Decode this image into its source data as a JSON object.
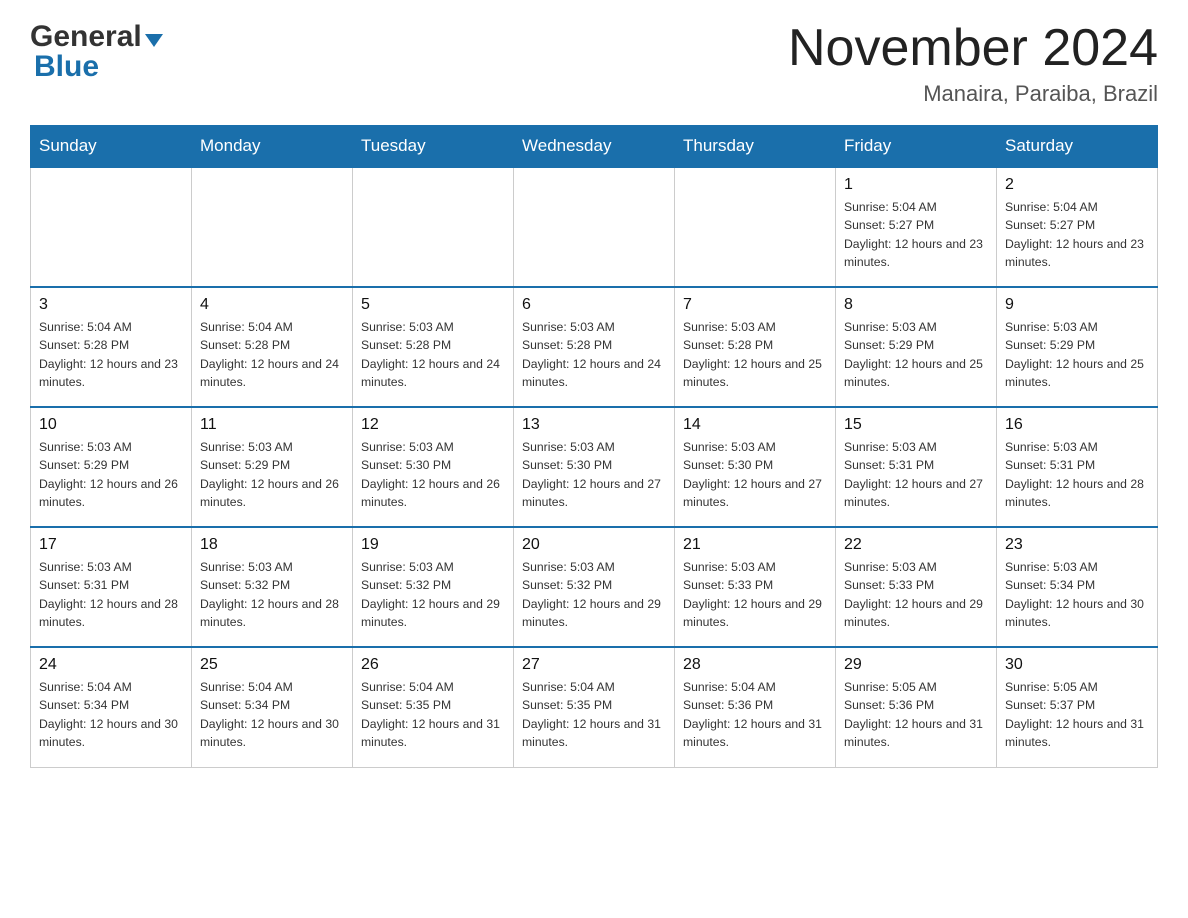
{
  "header": {
    "logo_general": "General",
    "logo_blue": "Blue",
    "month_title": "November 2024",
    "location": "Manaira, Paraiba, Brazil"
  },
  "weekdays": [
    "Sunday",
    "Monday",
    "Tuesday",
    "Wednesday",
    "Thursday",
    "Friday",
    "Saturday"
  ],
  "weeks": [
    [
      {
        "day": "",
        "sunrise": "",
        "sunset": "",
        "daylight": ""
      },
      {
        "day": "",
        "sunrise": "",
        "sunset": "",
        "daylight": ""
      },
      {
        "day": "",
        "sunrise": "",
        "sunset": "",
        "daylight": ""
      },
      {
        "day": "",
        "sunrise": "",
        "sunset": "",
        "daylight": ""
      },
      {
        "day": "",
        "sunrise": "",
        "sunset": "",
        "daylight": ""
      },
      {
        "day": "1",
        "sunrise": "Sunrise: 5:04 AM",
        "sunset": "Sunset: 5:27 PM",
        "daylight": "Daylight: 12 hours and 23 minutes."
      },
      {
        "day": "2",
        "sunrise": "Sunrise: 5:04 AM",
        "sunset": "Sunset: 5:27 PM",
        "daylight": "Daylight: 12 hours and 23 minutes."
      }
    ],
    [
      {
        "day": "3",
        "sunrise": "Sunrise: 5:04 AM",
        "sunset": "Sunset: 5:28 PM",
        "daylight": "Daylight: 12 hours and 23 minutes."
      },
      {
        "day": "4",
        "sunrise": "Sunrise: 5:04 AM",
        "sunset": "Sunset: 5:28 PM",
        "daylight": "Daylight: 12 hours and 24 minutes."
      },
      {
        "day": "5",
        "sunrise": "Sunrise: 5:03 AM",
        "sunset": "Sunset: 5:28 PM",
        "daylight": "Daylight: 12 hours and 24 minutes."
      },
      {
        "day": "6",
        "sunrise": "Sunrise: 5:03 AM",
        "sunset": "Sunset: 5:28 PM",
        "daylight": "Daylight: 12 hours and 24 minutes."
      },
      {
        "day": "7",
        "sunrise": "Sunrise: 5:03 AM",
        "sunset": "Sunset: 5:28 PM",
        "daylight": "Daylight: 12 hours and 25 minutes."
      },
      {
        "day": "8",
        "sunrise": "Sunrise: 5:03 AM",
        "sunset": "Sunset: 5:29 PM",
        "daylight": "Daylight: 12 hours and 25 minutes."
      },
      {
        "day": "9",
        "sunrise": "Sunrise: 5:03 AM",
        "sunset": "Sunset: 5:29 PM",
        "daylight": "Daylight: 12 hours and 25 minutes."
      }
    ],
    [
      {
        "day": "10",
        "sunrise": "Sunrise: 5:03 AM",
        "sunset": "Sunset: 5:29 PM",
        "daylight": "Daylight: 12 hours and 26 minutes."
      },
      {
        "day": "11",
        "sunrise": "Sunrise: 5:03 AM",
        "sunset": "Sunset: 5:29 PM",
        "daylight": "Daylight: 12 hours and 26 minutes."
      },
      {
        "day": "12",
        "sunrise": "Sunrise: 5:03 AM",
        "sunset": "Sunset: 5:30 PM",
        "daylight": "Daylight: 12 hours and 26 minutes."
      },
      {
        "day": "13",
        "sunrise": "Sunrise: 5:03 AM",
        "sunset": "Sunset: 5:30 PM",
        "daylight": "Daylight: 12 hours and 27 minutes."
      },
      {
        "day": "14",
        "sunrise": "Sunrise: 5:03 AM",
        "sunset": "Sunset: 5:30 PM",
        "daylight": "Daylight: 12 hours and 27 minutes."
      },
      {
        "day": "15",
        "sunrise": "Sunrise: 5:03 AM",
        "sunset": "Sunset: 5:31 PM",
        "daylight": "Daylight: 12 hours and 27 minutes."
      },
      {
        "day": "16",
        "sunrise": "Sunrise: 5:03 AM",
        "sunset": "Sunset: 5:31 PM",
        "daylight": "Daylight: 12 hours and 28 minutes."
      }
    ],
    [
      {
        "day": "17",
        "sunrise": "Sunrise: 5:03 AM",
        "sunset": "Sunset: 5:31 PM",
        "daylight": "Daylight: 12 hours and 28 minutes."
      },
      {
        "day": "18",
        "sunrise": "Sunrise: 5:03 AM",
        "sunset": "Sunset: 5:32 PM",
        "daylight": "Daylight: 12 hours and 28 minutes."
      },
      {
        "day": "19",
        "sunrise": "Sunrise: 5:03 AM",
        "sunset": "Sunset: 5:32 PM",
        "daylight": "Daylight: 12 hours and 29 minutes."
      },
      {
        "day": "20",
        "sunrise": "Sunrise: 5:03 AM",
        "sunset": "Sunset: 5:32 PM",
        "daylight": "Daylight: 12 hours and 29 minutes."
      },
      {
        "day": "21",
        "sunrise": "Sunrise: 5:03 AM",
        "sunset": "Sunset: 5:33 PM",
        "daylight": "Daylight: 12 hours and 29 minutes."
      },
      {
        "day": "22",
        "sunrise": "Sunrise: 5:03 AM",
        "sunset": "Sunset: 5:33 PM",
        "daylight": "Daylight: 12 hours and 29 minutes."
      },
      {
        "day": "23",
        "sunrise": "Sunrise: 5:03 AM",
        "sunset": "Sunset: 5:34 PM",
        "daylight": "Daylight: 12 hours and 30 minutes."
      }
    ],
    [
      {
        "day": "24",
        "sunrise": "Sunrise: 5:04 AM",
        "sunset": "Sunset: 5:34 PM",
        "daylight": "Daylight: 12 hours and 30 minutes."
      },
      {
        "day": "25",
        "sunrise": "Sunrise: 5:04 AM",
        "sunset": "Sunset: 5:34 PM",
        "daylight": "Daylight: 12 hours and 30 minutes."
      },
      {
        "day": "26",
        "sunrise": "Sunrise: 5:04 AM",
        "sunset": "Sunset: 5:35 PM",
        "daylight": "Daylight: 12 hours and 31 minutes."
      },
      {
        "day": "27",
        "sunrise": "Sunrise: 5:04 AM",
        "sunset": "Sunset: 5:35 PM",
        "daylight": "Daylight: 12 hours and 31 minutes."
      },
      {
        "day": "28",
        "sunrise": "Sunrise: 5:04 AM",
        "sunset": "Sunset: 5:36 PM",
        "daylight": "Daylight: 12 hours and 31 minutes."
      },
      {
        "day": "29",
        "sunrise": "Sunrise: 5:05 AM",
        "sunset": "Sunset: 5:36 PM",
        "daylight": "Daylight: 12 hours and 31 minutes."
      },
      {
        "day": "30",
        "sunrise": "Sunrise: 5:05 AM",
        "sunset": "Sunset: 5:37 PM",
        "daylight": "Daylight: 12 hours and 31 minutes."
      }
    ]
  ]
}
